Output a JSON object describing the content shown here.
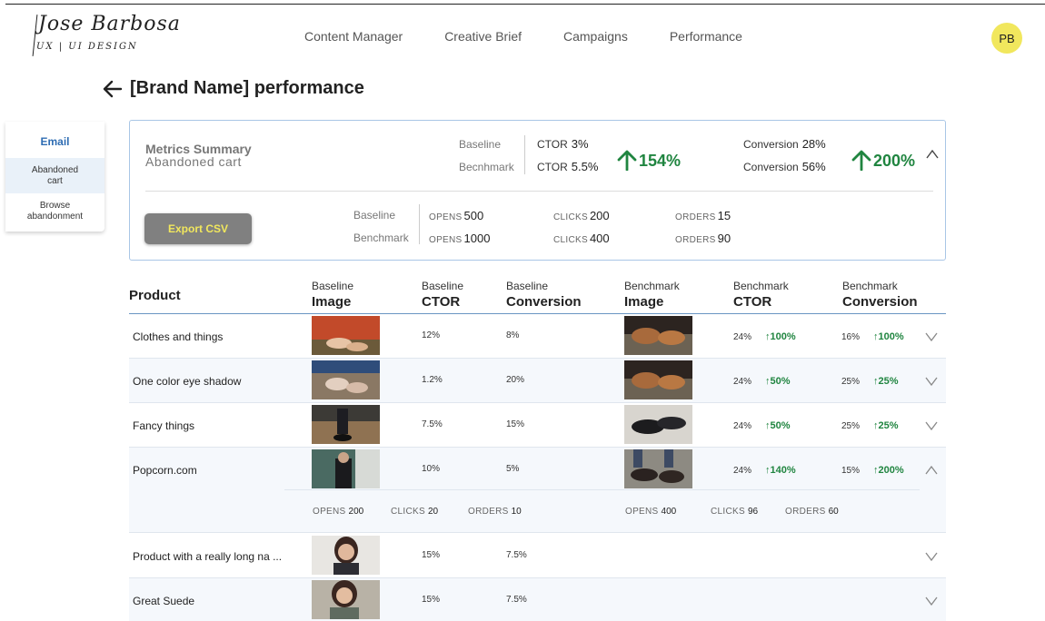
{
  "logo": {
    "script": "Jose Barbosa",
    "tagline": "UX | UI DESIGN"
  },
  "nav": [
    "Content Manager",
    "Creative Brief",
    "Campaigns",
    "Performance"
  ],
  "avatar": "PB",
  "page": {
    "title": "[Brand Name] performance"
  },
  "sidebar": {
    "email": "Email",
    "items": [
      "Abandoned cart",
      "Browse abandonment"
    ]
  },
  "summary": {
    "title": "Metrics Summary",
    "subtitle": "Abandoned cart",
    "baseline_label": "Baseline",
    "benchmark_label": "Becnhmark",
    "ctor_label": "CTOR",
    "ctor_baseline": "3%",
    "ctor_benchmark": "5.5%",
    "ctor_change": "154%",
    "conversion_label": "Conversion",
    "conv_baseline": "28%",
    "conv_benchmark": "56%",
    "conv_change": "200%",
    "export_label": "Export CSV",
    "counts_baseline_label": "Baseline",
    "counts_benchmark_label": "Benchmark",
    "opens_label": "OPENS",
    "clicks_label": "CLICKS",
    "orders_label": "ORDERS",
    "baseline_opens": "500",
    "baseline_clicks": "200",
    "baseline_orders": "15",
    "benchmark_opens": "1000",
    "benchmark_clicks": "400",
    "benchmark_orders": "90"
  },
  "table": {
    "headers": {
      "product": "Product",
      "b_img_1": "Baseline",
      "b_img_2": "Image",
      "b_ctor_1": "Baseline",
      "b_ctor_2": "CTOR",
      "b_conv_1": "Baseline",
      "b_conv_2": "Conversion",
      "m_img_1": "Benchmark",
      "m_img_2": "Image",
      "m_ctor_1": "Benchmark",
      "m_ctor_2": "CTOR",
      "m_conv_1": "Benchmark",
      "m_conv_2": "Conversion"
    },
    "rows": [
      {
        "product": "Clothes and things",
        "b_ctor": "12%",
        "b_conv": "8%",
        "m_ctor": "24%",
        "m_ctor_up": "↑100%",
        "m_conv": "16%",
        "m_conv_up": "↑100%"
      },
      {
        "product": "One color eye shadow",
        "b_ctor": "1.2%",
        "b_conv": "20%",
        "m_ctor": "24%",
        "m_ctor_up": "↑50%",
        "m_conv": "25%",
        "m_conv_up": "↑25%"
      },
      {
        "product": "Fancy things",
        "b_ctor": "7.5%",
        "b_conv": "15%",
        "m_ctor": "24%",
        "m_ctor_up": "↑50%",
        "m_conv": "25%",
        "m_conv_up": "↑25%"
      },
      {
        "product": "Popcorn.com",
        "b_ctor": "10%",
        "b_conv": "5%",
        "m_ctor": "24%",
        "m_ctor_up": "↑140%",
        "m_conv": "15%",
        "m_conv_up": "↑200%"
      },
      {
        "product": "Product with a really long na ...",
        "b_ctor": "15%",
        "b_conv": "7.5%"
      },
      {
        "product": "Great Suede",
        "b_ctor": "15%",
        "b_conv": "7.5%"
      }
    ],
    "detail": {
      "opens_label": "OPENS",
      "clicks_label": "CLICKS",
      "orders_label": "ORDERS",
      "b_opens": "200",
      "b_clicks": "20",
      "b_orders": "10",
      "m_opens": "400",
      "m_clicks": "96",
      "m_orders": "60"
    }
  },
  "colors": {
    "accent_blue": "#2f6db3",
    "positive_green": "#208540",
    "avatar_yellow": "#f1e75d",
    "button_gray": "#808080"
  }
}
